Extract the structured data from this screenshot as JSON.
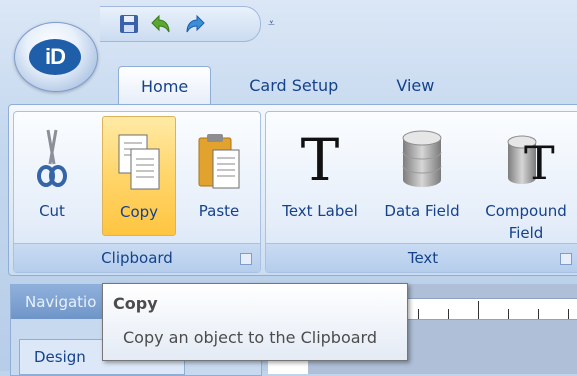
{
  "app": {
    "logo_text": "iD"
  },
  "quick_access": {
    "icons": [
      "save-icon",
      "undo-icon",
      "redo-icon",
      "customize-dropdown-icon"
    ],
    "customize_glyph": "⩡"
  },
  "tabs": [
    {
      "label": "Home",
      "active": true
    },
    {
      "label": "Card Setup",
      "active": false
    },
    {
      "label": "View",
      "active": false
    }
  ],
  "ribbon": {
    "clipboard": {
      "label": "Clipboard",
      "buttons": [
        {
          "label": "Cut",
          "icon": "scissors-icon"
        },
        {
          "label": "Copy",
          "icon": "copy-icon",
          "state": "hover"
        },
        {
          "label": "Paste",
          "icon": "paste-icon"
        }
      ]
    },
    "text": {
      "label": "Text",
      "buttons": [
        {
          "label": "Text Label",
          "icon": "text-label-icon",
          "glyph": "T"
        },
        {
          "label": "Data Field",
          "icon": "database-icon"
        },
        {
          "label_line1": "Compound",
          "label_line2": "Field",
          "icon": "compound-field-icon",
          "glyph": "T"
        }
      ]
    }
  },
  "navigation": {
    "header": "Navigatio",
    "item": "Design"
  },
  "tooltip": {
    "title": "Copy",
    "description": "Copy an object to the Clipboard"
  },
  "colors": {
    "accent": "#15428b",
    "hover": "#ffd56b",
    "ribbon_bg": "#dfe9f6"
  }
}
